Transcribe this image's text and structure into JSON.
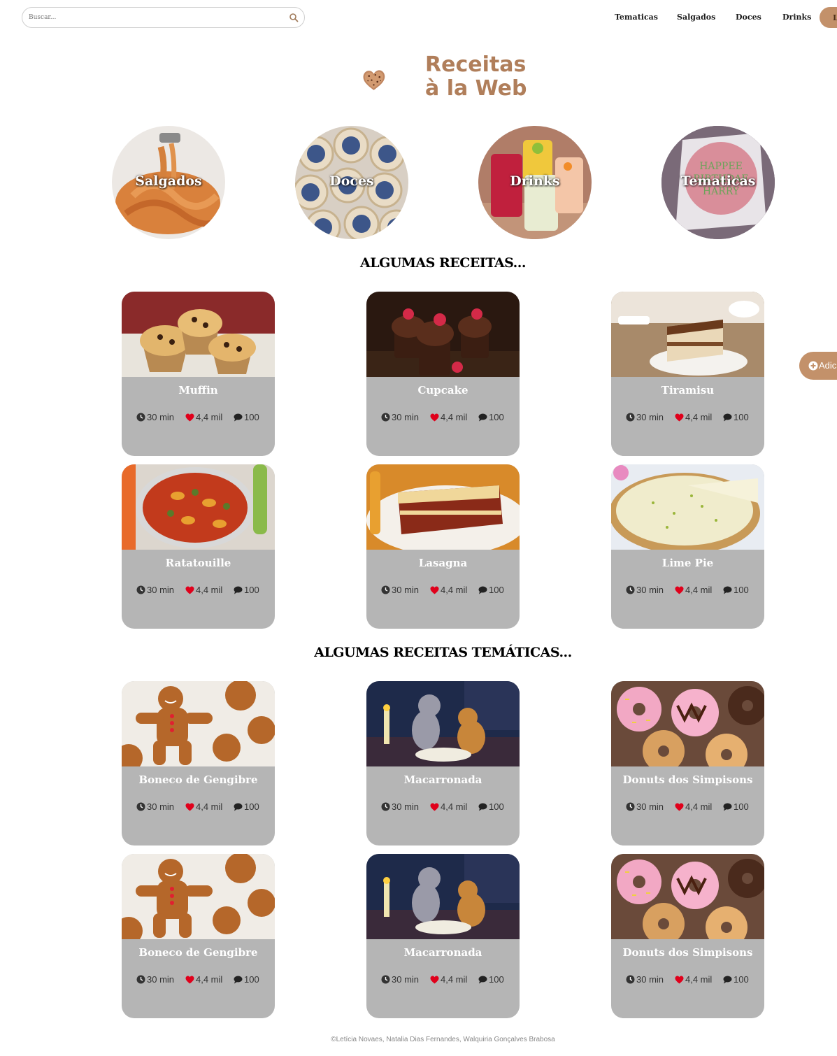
{
  "search": {
    "placeholder": "Buscar..."
  },
  "nav": {
    "items": [
      {
        "label": "Tematicas"
      },
      {
        "label": "Salgados"
      },
      {
        "label": "Doces"
      },
      {
        "label": "Drinks"
      }
    ],
    "login_label": "L"
  },
  "logo": {
    "line1": "Receitas",
    "line2": "à la Web"
  },
  "categories": [
    {
      "label": "Salgados"
    },
    {
      "label": "Doces"
    },
    {
      "label": "Drinks"
    },
    {
      "label": "Tematicas"
    }
  ],
  "sections": {
    "recipes_title": "ALGUMAS RECEITAS...",
    "themed_title": "ALGUMAS RECEITAS TEMÁTICAS..."
  },
  "recipes": [
    {
      "name": "Muffin",
      "time": "30 min",
      "likes": "4,4 mil",
      "comments": "100"
    },
    {
      "name": "Cupcake",
      "time": "30 min",
      "likes": "4,4 mil",
      "comments": "100"
    },
    {
      "name": "Tiramisu",
      "time": "30 min",
      "likes": "4,4 mil",
      "comments": "100"
    },
    {
      "name": "Ratatouille",
      "time": "30 min",
      "likes": "4,4 mil",
      "comments": "100"
    },
    {
      "name": "Lasagna",
      "time": "30 min",
      "likes": "4,4 mil",
      "comments": "100"
    },
    {
      "name": "Lime Pie",
      "time": "30 min",
      "likes": "4,4 mil",
      "comments": "100"
    }
  ],
  "themed": [
    {
      "name": "Boneco de Gengibre",
      "time": "30 min",
      "likes": "4,4 mil",
      "comments": "100"
    },
    {
      "name": "Macarronada",
      "time": "30 min",
      "likes": "4,4 mil",
      "comments": "100"
    },
    {
      "name": "Donuts dos Simpisons",
      "time": "30 min",
      "likes": "4,4 mil",
      "comments": "100"
    },
    {
      "name": "Boneco de Gengibre",
      "time": "30 min",
      "likes": "4,4 mil",
      "comments": "100"
    },
    {
      "name": "Macarronada",
      "time": "30 min",
      "likes": "4,4 mil",
      "comments": "100"
    },
    {
      "name": "Donuts dos Simpisons",
      "time": "30 min",
      "likes": "4,4 mil",
      "comments": "100"
    }
  ],
  "add_button": {
    "label": "Adic"
  },
  "footer": {
    "text": "©Letícia Novaes, Natalia Dias Fernandes, Walquiria Gonçalves Brabosa"
  },
  "colors": {
    "accent": "#c3916a",
    "card_bg": "#b5b5b5",
    "heart": "#e0001b",
    "logo": "#b07e5a"
  }
}
